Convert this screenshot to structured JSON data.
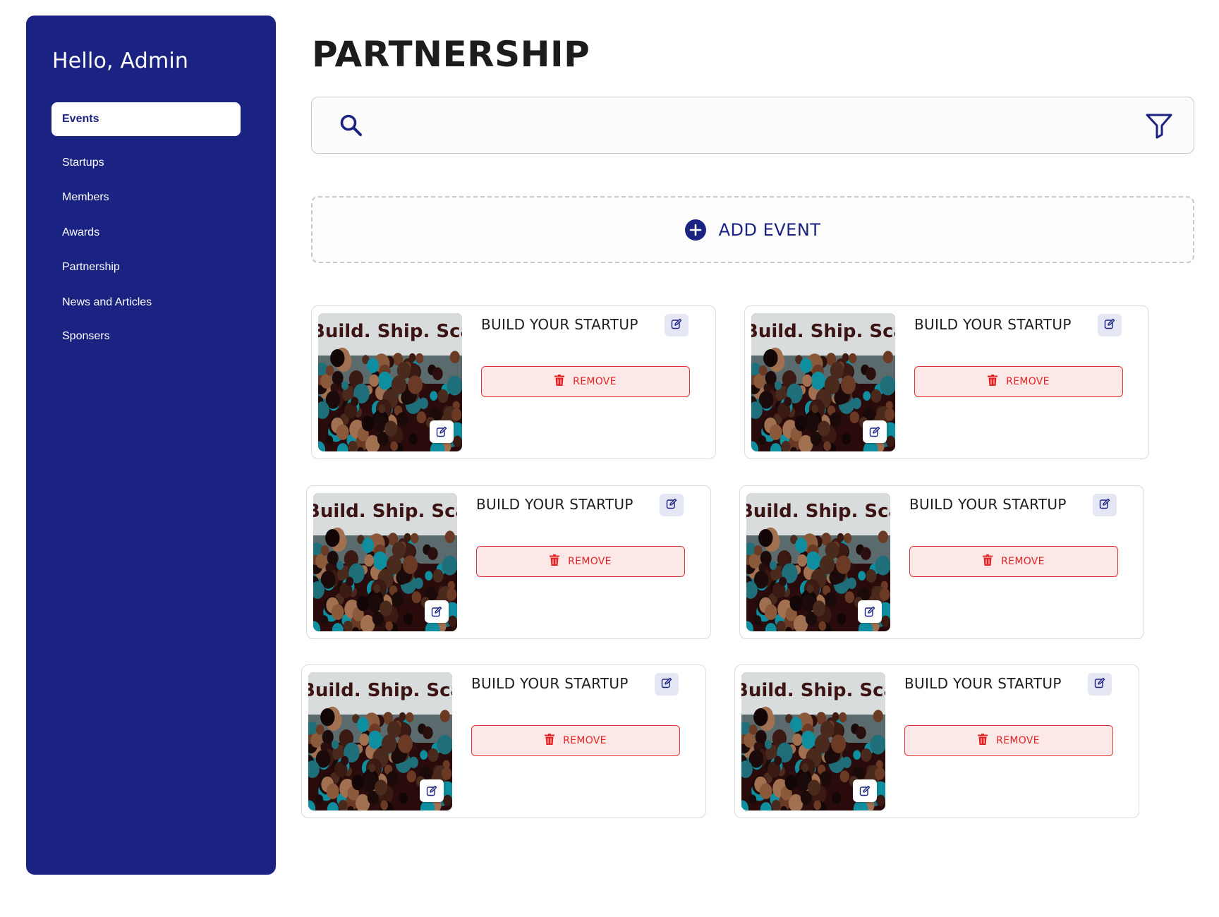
{
  "sidebar": {
    "greeting": "Hello, Admin",
    "items": [
      {
        "label": "Events",
        "active": true
      },
      {
        "label": "Startups",
        "active": false
      },
      {
        "label": "Members",
        "active": false
      },
      {
        "label": "Awards",
        "active": false
      },
      {
        "label": "Partnership",
        "active": false
      },
      {
        "label": "News and Articles",
        "active": false
      },
      {
        "label": "Sponsers",
        "active": false
      }
    ]
  },
  "main": {
    "title": "PARTNERSHIP",
    "search": {
      "value": "",
      "placeholder": ""
    },
    "add_event_label": "ADD EVENT",
    "cards": [
      {
        "title": "BUILD YOUR STARTUP",
        "image_text": "Build. Ship. Scale",
        "remove_label": "REMOVE"
      },
      {
        "title": "BUILD YOUR STARTUP",
        "image_text": "Build. Ship. Scale",
        "remove_label": "REMOVE"
      },
      {
        "title": "BUILD YOUR STARTUP",
        "image_text": "Build. Ship. Scale",
        "remove_label": "REMOVE"
      },
      {
        "title": "BUILD YOUR STARTUP",
        "image_text": "Build. Ship. Scale",
        "remove_label": "REMOVE"
      },
      {
        "title": "BUILD YOUR STARTUP",
        "image_text": "Build. Ship. Scale",
        "remove_label": "REMOVE"
      },
      {
        "title": "BUILD YOUR STARTUP",
        "image_text": "Build. Ship. Scale",
        "remove_label": "REMOVE"
      }
    ]
  },
  "icons": {
    "search": "search-icon",
    "filter": "filter-icon",
    "add": "plus-circle-icon",
    "edit": "edit-icon",
    "remove": "trash-icon"
  },
  "colors": {
    "brand": "#1a2282",
    "danger": "#e02424",
    "danger_bg": "#fde8e8",
    "edit_bg": "#e6e7f4"
  }
}
